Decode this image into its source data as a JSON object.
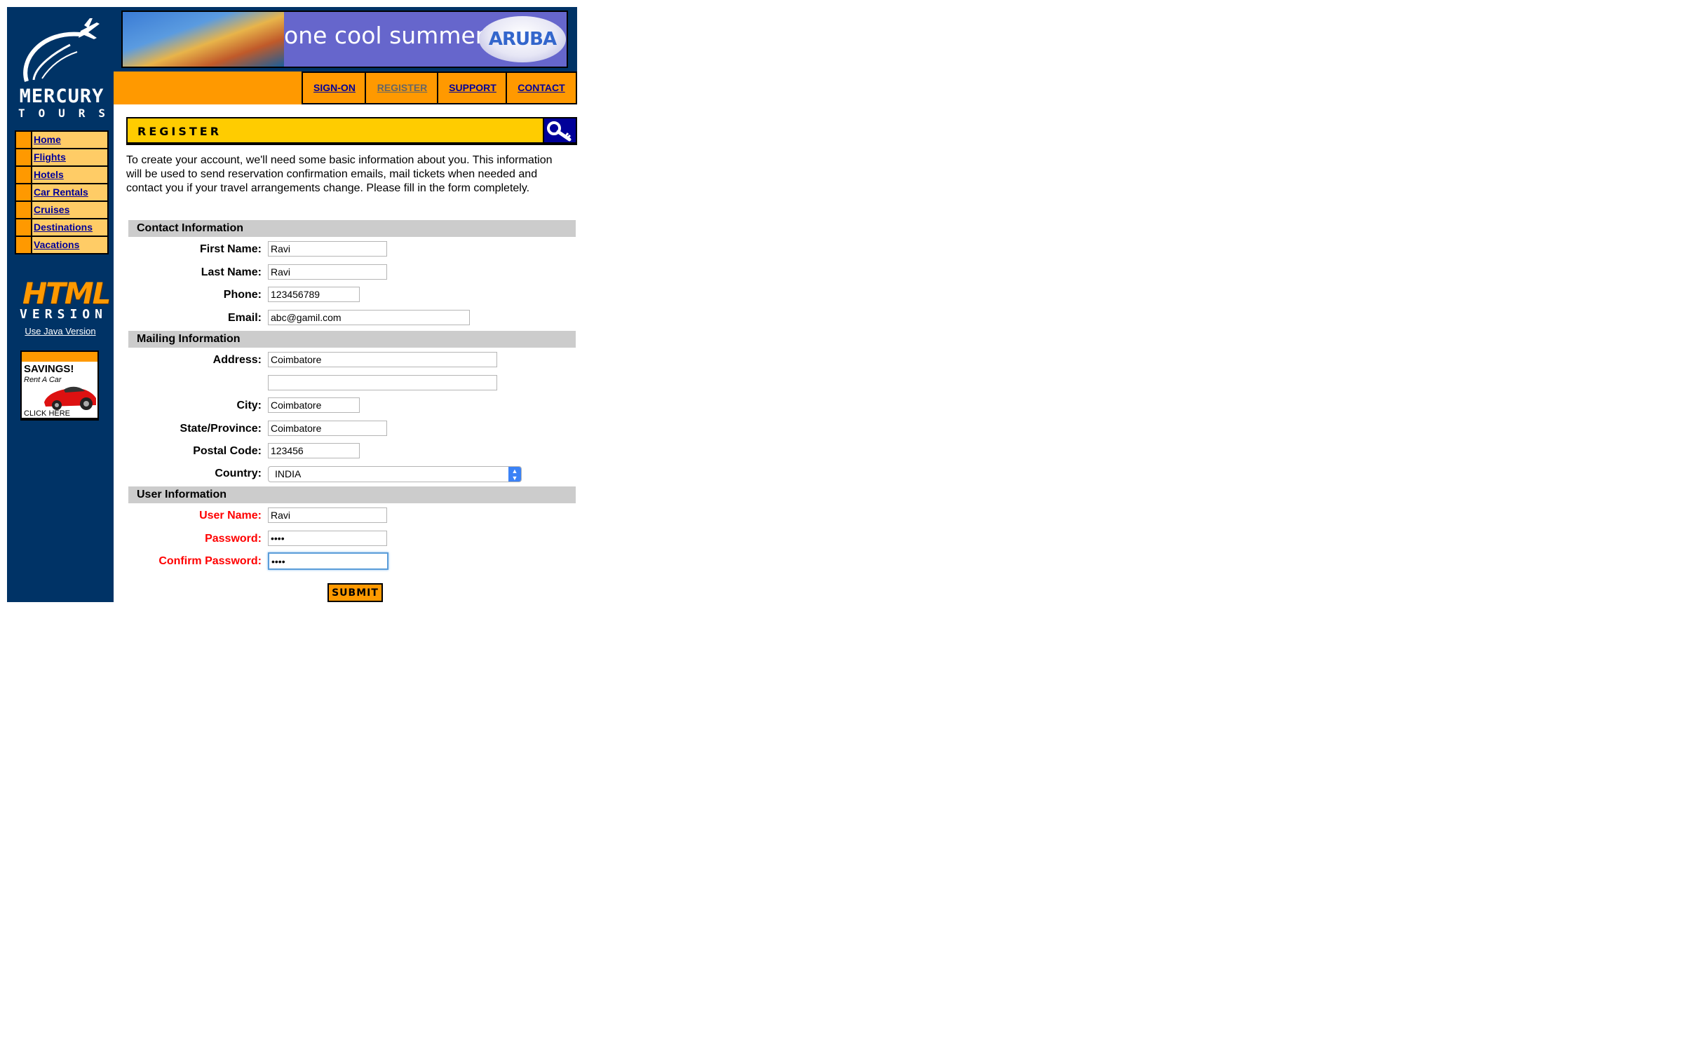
{
  "logo": {
    "line1": "MERCURY",
    "line2": [
      "T",
      "O",
      "U",
      "R",
      "S"
    ]
  },
  "sidebar": {
    "items": [
      {
        "label": "Home"
      },
      {
        "label": "Flights"
      },
      {
        "label": "Hotels"
      },
      {
        "label": "Car Rentals"
      },
      {
        "label": "Cruises"
      },
      {
        "label": "Destinations"
      },
      {
        "label": "Vacations"
      }
    ],
    "html_version_big": "HTML",
    "html_version_small": [
      "V",
      "E",
      "R",
      "S",
      "I",
      "O",
      "N"
    ],
    "java_link": "Use Java Version",
    "savings": {
      "title": "SAVINGS!",
      "subtitle": "Rent A Car",
      "cta": "CLICK HERE"
    }
  },
  "banner": {
    "tagline": "one cool summer",
    "brand": "ARUBA"
  },
  "topnav": {
    "signon": "SIGN-ON",
    "register": "REGISTER",
    "support": "SUPPORT",
    "contact": "CONTACT"
  },
  "page": {
    "title": "REGISTER",
    "intro": "To create your account, we'll need some basic information about you. This information will be used to send reservation confirmation emails, mail tickets when needed and contact you if your travel arrangements change. Please fill in the form completely."
  },
  "form": {
    "contact_section": "Contact Information",
    "first_name": {
      "label": "First Name:",
      "value": "Ravi"
    },
    "last_name": {
      "label": "Last Name:",
      "value": "Ravi"
    },
    "phone": {
      "label": "Phone:",
      "value": "123456789"
    },
    "email": {
      "label": "Email:",
      "value": "abc@gamil.com"
    },
    "mailing_section": "Mailing Information",
    "address": {
      "label": "Address:",
      "value": "Coimbatore",
      "value2": ""
    },
    "city": {
      "label": "City:",
      "value": "Coimbatore"
    },
    "state": {
      "label": "State/Province:",
      "value": "Coimbatore"
    },
    "postal": {
      "label": "Postal Code:",
      "value": "123456"
    },
    "country": {
      "label": "Country:",
      "value": "INDIA"
    },
    "user_section": "User Information",
    "username": {
      "label": "User Name:",
      "value": "Ravi"
    },
    "password": {
      "label": "Password:",
      "value": "1234"
    },
    "confirm_password": {
      "label": "Confirm Password:",
      "value": "1234"
    },
    "submit": "SUBMIT"
  },
  "colors": {
    "sidebar": "#003366",
    "accent": "#ff9900",
    "header_yellow": "#ffcc00",
    "link": "#000099",
    "required": "#ff0000"
  },
  "icons": [
    "airplane-logo-icon",
    "key-icon",
    "select-arrows-icon"
  ]
}
